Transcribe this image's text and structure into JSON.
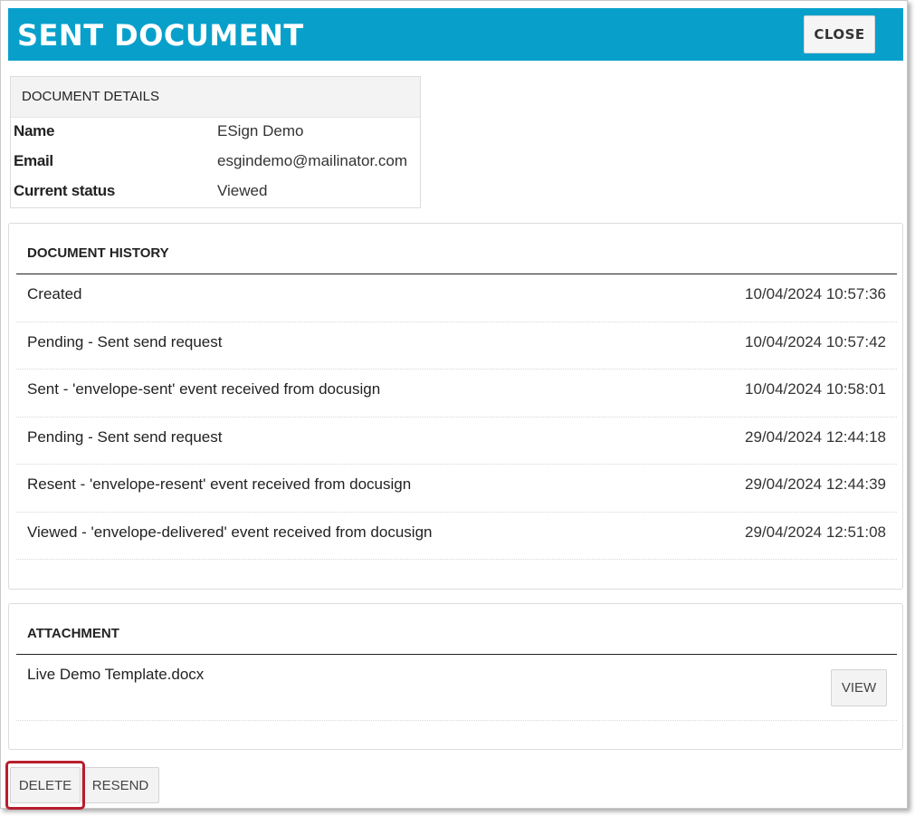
{
  "dialog": {
    "title": "SENT DOCUMENT",
    "close_label": "CLOSE",
    "header_color": "#08a0cb"
  },
  "details": {
    "header": "DOCUMENT DETAILS",
    "rows": [
      {
        "label": "Name",
        "value": "ESign Demo"
      },
      {
        "label": "Email",
        "value": "esgindemo@mailinator.com"
      },
      {
        "label": "Current status",
        "value": "Viewed"
      }
    ]
  },
  "history": {
    "header": "DOCUMENT HISTORY",
    "rows": [
      {
        "event": "Created",
        "time": "10/04/2024 10:57:36"
      },
      {
        "event": "Pending - Sent send request",
        "time": "10/04/2024 10:57:42"
      },
      {
        "event": "Sent - 'envelope-sent' event received from docusign",
        "time": "10/04/2024 10:58:01"
      },
      {
        "event": "Pending - Sent send request",
        "time": "29/04/2024 12:44:18"
      },
      {
        "event": "Resent - 'envelope-resent' event received from docusign",
        "time": "29/04/2024 12:44:39"
      },
      {
        "event": "Viewed - 'envelope-delivered' event received from docusign",
        "time": "29/04/2024 12:51:08"
      }
    ]
  },
  "attachment": {
    "header": "ATTACHMENT",
    "file_name": "Live Demo Template.docx",
    "view_label": "VIEW"
  },
  "footer": {
    "delete_label": "DELETE",
    "resend_label": "RESEND",
    "highlight_color": "#b81e2e"
  }
}
